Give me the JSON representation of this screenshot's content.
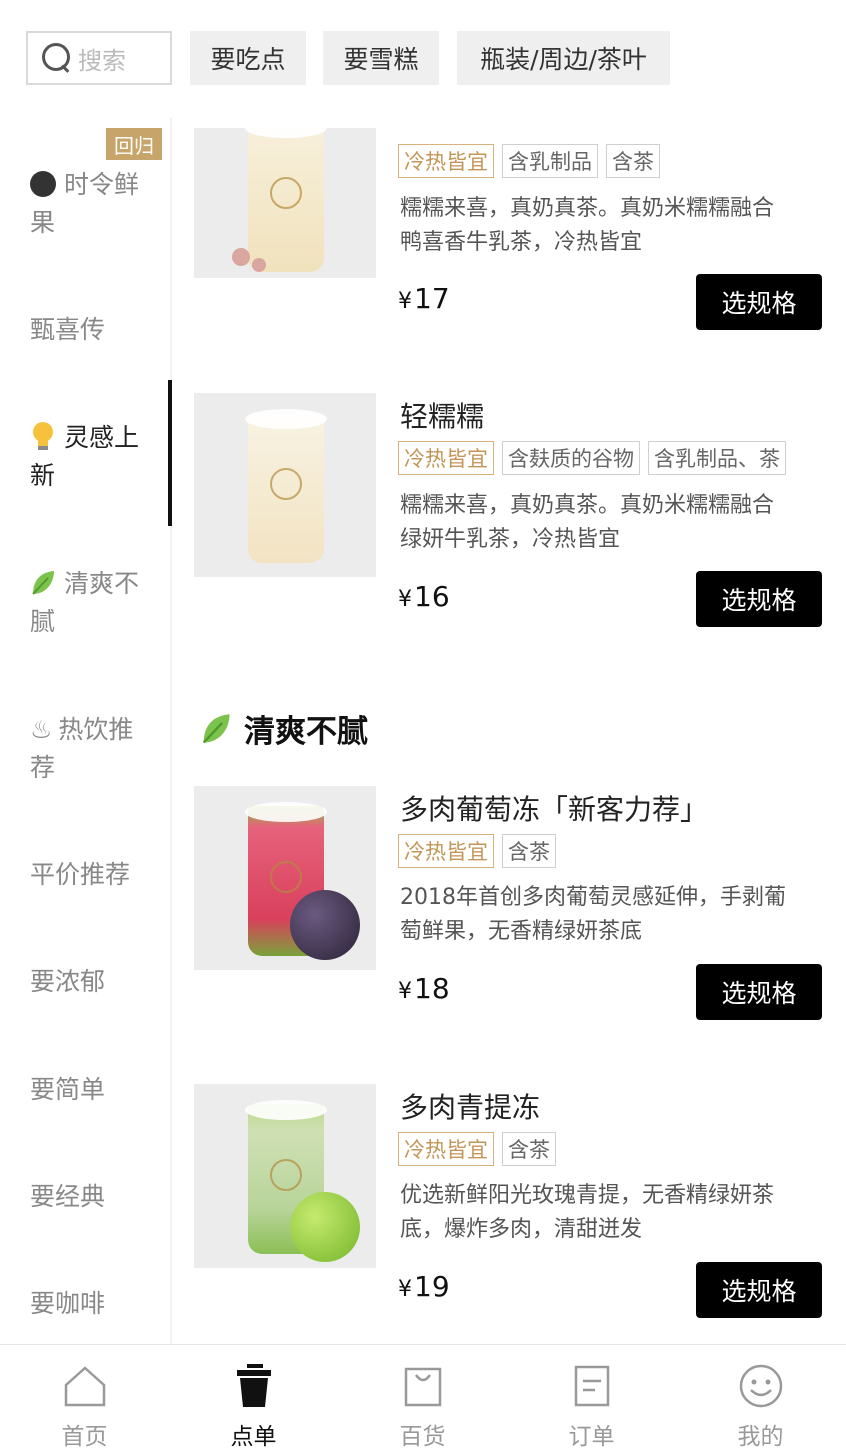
{
  "search": {
    "placeholder": "搜索"
  },
  "filters": [
    "要吃点",
    "要雪糕",
    "瓶装/周边/茶叶"
  ],
  "sidebar": {
    "badge": "回归",
    "items": [
      {
        "label": "时令鲜果",
        "icon": "black-dot-icon",
        "line1": "时令鲜",
        "line2": "果"
      },
      {
        "label": "甄喜传",
        "line1": "甄喜传",
        "line2": ""
      },
      {
        "label": "灵感上新",
        "icon": "lightbulb-icon",
        "line1": "灵感上",
        "line2": "新",
        "active": true
      },
      {
        "label": "清爽不腻",
        "icon": "leaf-icon",
        "line1": "清爽不",
        "line2": "腻"
      },
      {
        "label": "热饮推荐",
        "icon": "hot-steam-icon",
        "line1": "热饮推",
        "line2": "荐"
      },
      {
        "label": "平价推荐",
        "line1": "平价推荐",
        "line2": ""
      },
      {
        "label": "要浓郁",
        "line1": "要浓郁",
        "line2": ""
      },
      {
        "label": "要简单",
        "line1": "要简单",
        "line2": ""
      },
      {
        "label": "要经典",
        "line1": "要经典",
        "line2": ""
      },
      {
        "label": "要咖啡",
        "line1": "要咖啡",
        "line2": ""
      }
    ]
  },
  "section": {
    "title": "清爽不腻",
    "icon": "leaf-icon"
  },
  "products": [
    {
      "name": "",
      "tags": [
        "冷热皆宜",
        "含乳制品",
        "含茶"
      ],
      "desc1": "糯糯来喜，真奶真茶。真奶米糯糯融合",
      "desc2": "鸭喜香牛乳茶，冷热皆宜",
      "currency": "¥",
      "price": "17",
      "button": "选规格"
    },
    {
      "name": "轻糯糯",
      "tags": [
        "冷热皆宜",
        "含麸质的谷物",
        "含乳制品、茶"
      ],
      "desc1": "糯糯来喜，真奶真茶。真奶米糯糯融合",
      "desc2": "绿妍牛乳茶，冷热皆宜",
      "currency": "¥",
      "price": "16",
      "button": "选规格"
    },
    {
      "name": "多肉葡萄冻「新客力荐」",
      "tags": [
        "冷热皆宜",
        "含茶"
      ],
      "desc1": "2018年首创多肉葡萄灵感延伸，手剥葡",
      "desc2": "萄鲜果，无香精绿妍茶底",
      "currency": "¥",
      "price": "18",
      "button": "选规格"
    },
    {
      "name": "多肉青提冻",
      "tags": [
        "冷热皆宜",
        "含茶"
      ],
      "desc1": "优选新鲜阳光玫瑰青提，无香精绿妍茶",
      "desc2": "底，爆炸多肉，清甜迸发",
      "currency": "¥",
      "price": "19",
      "button": "选规格"
    }
  ],
  "tabbar": [
    {
      "label": "首页",
      "icon": "home-icon"
    },
    {
      "label": "点单",
      "icon": "cup-icon",
      "active": true
    },
    {
      "label": "百货",
      "icon": "shopping-bag-icon"
    },
    {
      "label": "订单",
      "icon": "order-list-icon"
    },
    {
      "label": "我的",
      "icon": "smiley-icon"
    }
  ],
  "colors": {
    "accent_gold": "#c7a56a",
    "button_black": "#000000"
  }
}
